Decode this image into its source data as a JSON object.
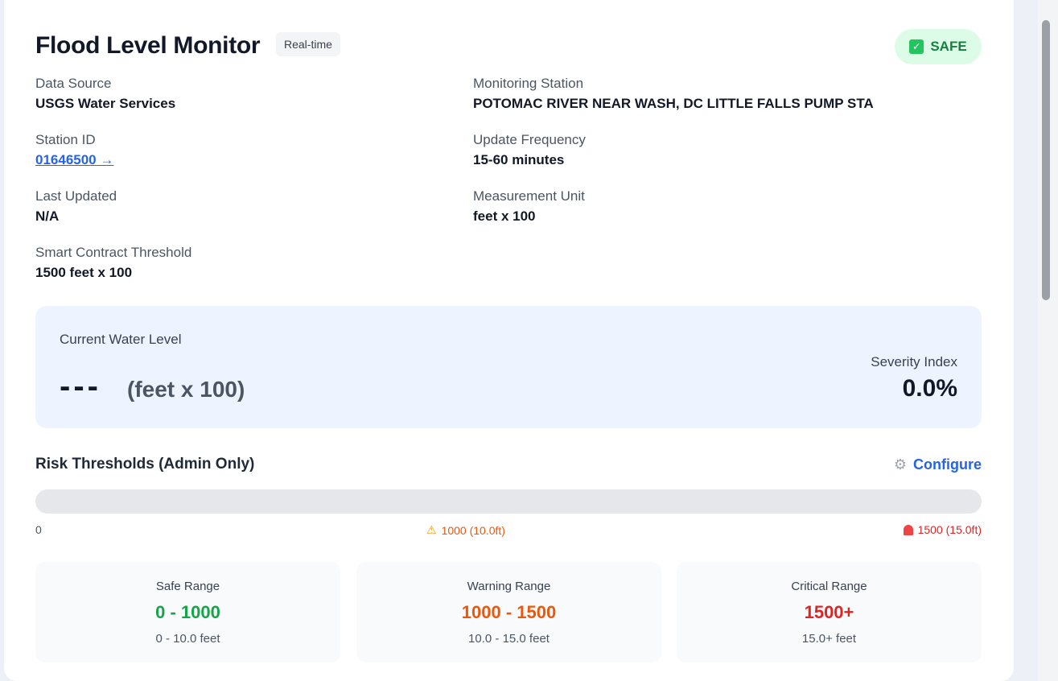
{
  "header": {
    "title": "Flood Level Monitor",
    "tag": "Real-time",
    "status": "SAFE",
    "status_icon": "check-icon"
  },
  "info": {
    "data_source_label": "Data Source",
    "data_source_value": "USGS Water Services",
    "station_label": "Monitoring Station",
    "station_value": "POTOMAC RIVER NEAR WASH, DC LITTLE FALLS PUMP STA",
    "station_id_label": "Station ID",
    "station_id_value": "01646500 →",
    "update_label": "Update Frequency",
    "update_value": "15-60 minutes",
    "last_updated_label": "Last Updated",
    "last_updated_value": "N/A",
    "unit_label": "Measurement Unit",
    "unit_value": "feet x 100",
    "threshold_label": "Smart Contract Threshold",
    "threshold_value": "1500 feet x 100"
  },
  "level": {
    "label": "Current Water Level",
    "value": "---",
    "unit": "(feet x 100)",
    "severity_label": "Severity Index",
    "severity_value": "0.0%"
  },
  "risk": {
    "title": "Risk Thresholds (Admin Only)",
    "configure_label": "Configure",
    "bar_fill_percent": 0,
    "scale_min": "0",
    "scale_warning": "1000 (10.0ft)",
    "scale_critical": "1500 (15.0ft)"
  },
  "ranges": [
    {
      "label": "Safe Range",
      "value": "0 - 1000",
      "sub": "0 - 10.0 feet",
      "color": "#16a34a"
    },
    {
      "label": "Warning Range",
      "value": "1000 - 1500",
      "sub": "10.0 - 15.0 feet",
      "color": "#ea580c"
    },
    {
      "label": "Critical Range",
      "value": "1500+",
      "sub": "15.0+ feet",
      "color": "#dc2626"
    }
  ]
}
